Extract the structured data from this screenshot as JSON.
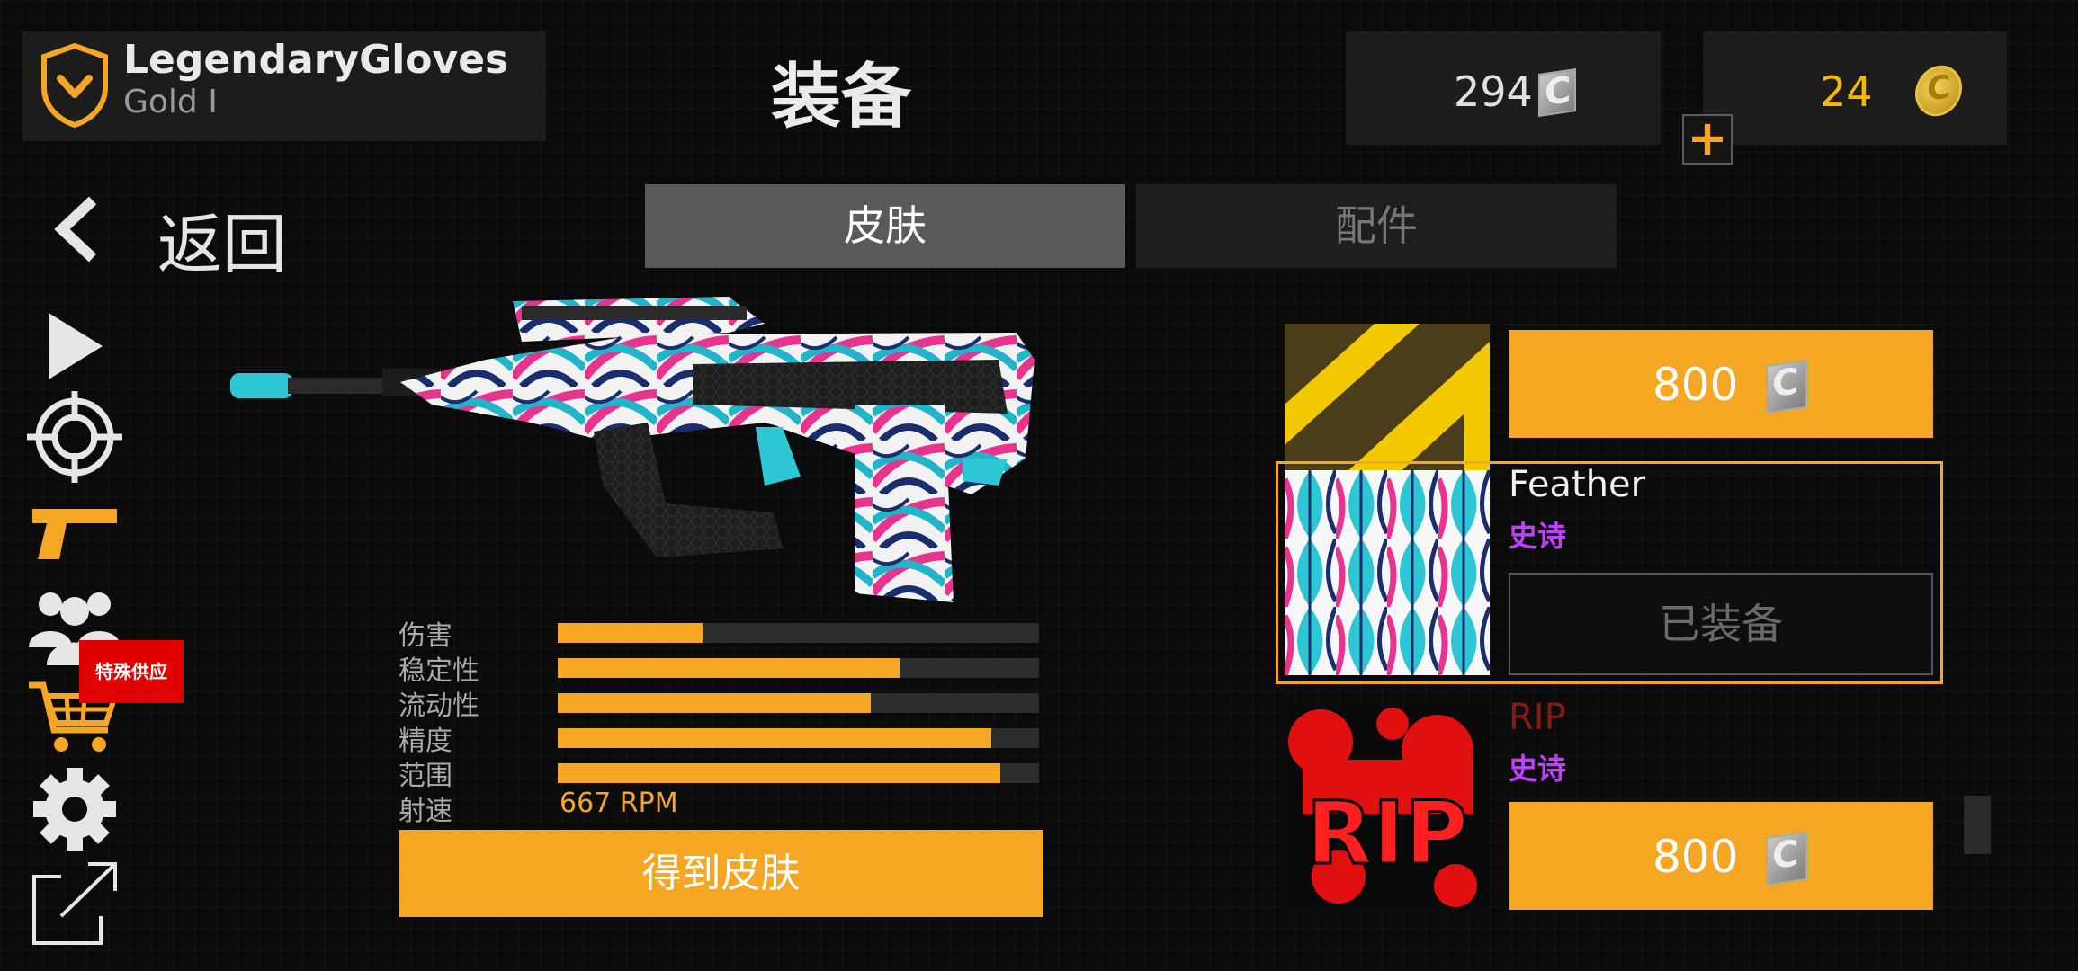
{
  "player": {
    "name": "LegendaryGloves",
    "rank": "Gold I"
  },
  "screen_title": "装备",
  "currency": {
    "credits": "294",
    "gold": "24",
    "add_gold_symbol": "+"
  },
  "back_label": "返回",
  "tabs": [
    {
      "label": "皮肤",
      "active": true
    },
    {
      "label": "配件",
      "active": false
    }
  ],
  "nav": [
    {
      "icon": "play-icon"
    },
    {
      "icon": "crosshair-icon"
    },
    {
      "icon": "pistol-icon",
      "active": true
    },
    {
      "icon": "squad-icon"
    },
    {
      "icon": "cart-icon",
      "badge": "特殊供应"
    },
    {
      "icon": "gear-icon"
    },
    {
      "icon": "external-link-icon"
    }
  ],
  "stats": [
    {
      "label": "伤害",
      "fraction": 0.3
    },
    {
      "label": "稳定性",
      "fraction": 0.71
    },
    {
      "label": "流动性",
      "fraction": 0.65
    },
    {
      "label": "精度",
      "fraction": 0.9
    },
    {
      "label": "范围",
      "fraction": 0.92
    }
  ],
  "fire_rate": {
    "label": "射速",
    "value": "667 RPM"
  },
  "get_skin_label": "得到皮肤",
  "skins": [
    {
      "thumb": "yellow-stripe",
      "price": "800"
    },
    {
      "name": "Feather",
      "rarity": "史诗",
      "status": "已装备",
      "selected": true
    },
    {
      "name": "RIP",
      "rarity": "史诗",
      "price": "800",
      "thumb_text": "RIP"
    }
  ],
  "colors": {
    "accent": "#f5a623",
    "epic": "#c040ff",
    "offer": "#e00000"
  }
}
